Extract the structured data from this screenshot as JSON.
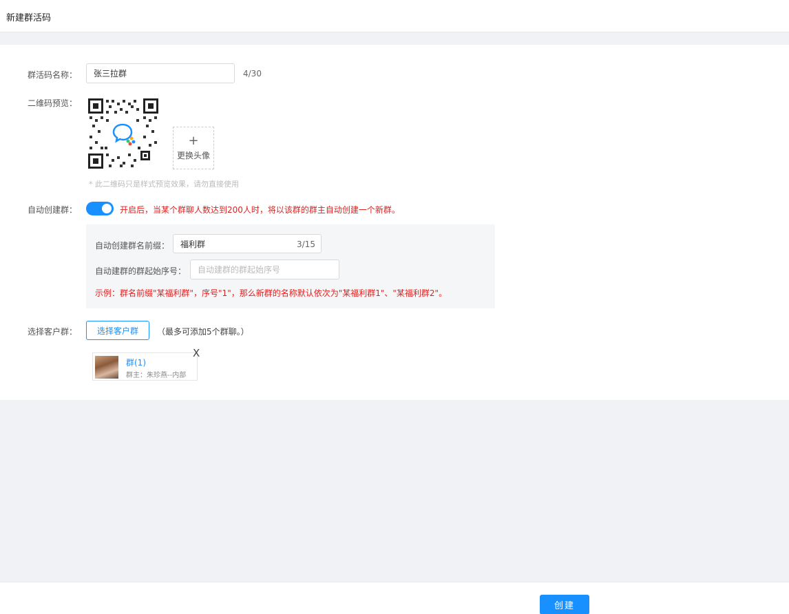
{
  "header": {
    "title": "新建群活码"
  },
  "form": {
    "name_label": "群活码名称：",
    "name_value": "张三拉群",
    "name_counter": "4/30",
    "qr_label": "二维码预览：",
    "avatar_plus": "+",
    "avatar_label": "更换头像",
    "qr_hint": "* 此二维码只是样式预览效果，请勿直接使用",
    "auto_label": "自动创建群：",
    "auto_enabled": true,
    "auto_hint": "开启后，当某个群聊人数达到200人时，将以该群的群主自动创建一个新群。",
    "prefix_label": "自动创建群名前缀：",
    "prefix_value": "福利群",
    "prefix_counter": "3/15",
    "start_label": "自动建群的群起始序号：",
    "start_placeholder": "自动建群的群起始序号",
    "example": "示例：群名前缀\"某福利群\"，序号\"1\"，那么新群的名称默认依次为\"某福利群1\"、\"某福利群2\"。",
    "select_label": "选择客户群：",
    "select_button": "选择客户群",
    "select_hint": "（最多可添加5个群聊。）",
    "selected_groups": [
      {
        "name": "群(1)",
        "owner": "群主：朱珍燕--内部",
        "close": "X"
      }
    ]
  },
  "footer": {
    "create_button": "创建"
  },
  "colors": {
    "primary": "#1890ff",
    "danger": "#e02020"
  }
}
